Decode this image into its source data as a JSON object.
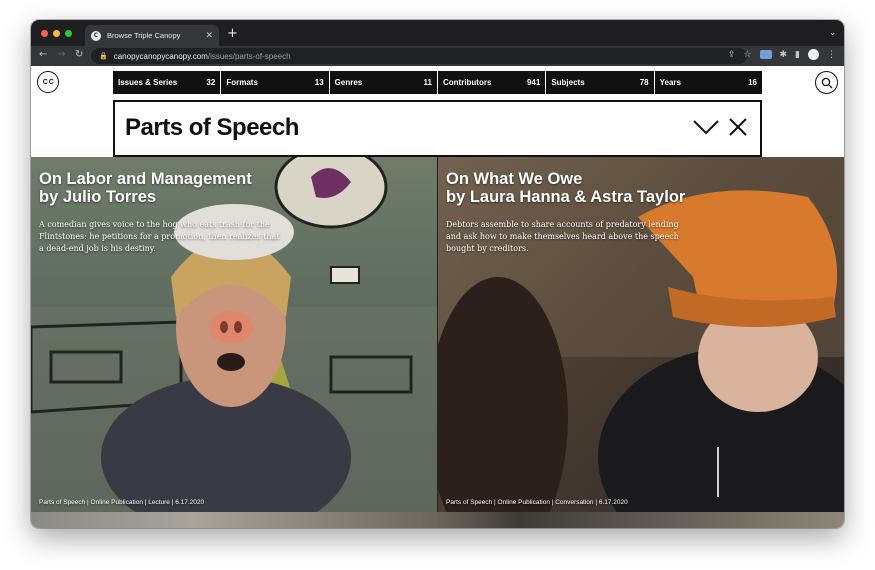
{
  "browser": {
    "tab_title": "Browse Triple Canopy",
    "favicon_text": "C",
    "new_tab_symbol": "+",
    "url_host": "canopycanopycanopy.com",
    "url_path": "/issues/parts-of-speech"
  },
  "site": {
    "logo_text": "C C"
  },
  "nav": {
    "items": [
      {
        "label": "Issues & Series",
        "count": "32"
      },
      {
        "label": "Formats",
        "count": "13"
      },
      {
        "label": "Genres",
        "count": "11"
      },
      {
        "label": "Contributors",
        "count": "941"
      },
      {
        "label": "Subjects",
        "count": "78"
      },
      {
        "label": "Years",
        "count": "16"
      }
    ]
  },
  "header": {
    "title": "Parts of Speech"
  },
  "cards": [
    {
      "title_line1": "On Labor and Management",
      "title_line2": "by Julio Torres",
      "description": "A comedian gives voice to the hog who eats trash for the Flintstones: he petitions for a promotion, then realizes that a dead-end job is his destiny.",
      "meta": "Parts of Speech | Online Publication | Lecture | 6.17.2020"
    },
    {
      "title_line1": "On What We Owe",
      "title_line2": "by Laura Hanna & Astra Taylor",
      "description": "Debtors assemble to share accounts of predatory lending and ask how to make themselves heard above the speech bought by creditors.",
      "meta": "Parts of Speech | Online Publication | Conversation | 6.17.2020"
    }
  ],
  "colors": {
    "nav_bg": "#111111",
    "tab_strip": "#1f1f21",
    "toolbar": "#35363a"
  }
}
